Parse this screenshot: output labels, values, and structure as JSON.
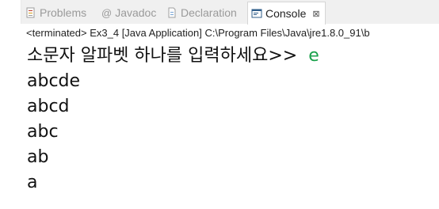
{
  "tabs": [
    {
      "label": "Problems",
      "icon": "problems-icon",
      "active": false
    },
    {
      "label": "Javadoc",
      "icon": "javadoc-icon",
      "active": false
    },
    {
      "label": "Declaration",
      "icon": "declaration-icon",
      "active": false
    },
    {
      "label": "Console",
      "icon": "console-icon",
      "active": true,
      "close_glyph": "⊠"
    }
  ],
  "status": "<terminated> Ex3_4 [Java Application] C:\\Program Files\\Java\\jre1.8.0_91\\b",
  "console": {
    "prompt": "소문자 알파벳 하나를 입력하세요>>",
    "user_input": "e",
    "output_lines": [
      "abcde",
      "abcd",
      "abc",
      "ab",
      "a"
    ]
  },
  "colors": {
    "input_green": "#1aa14b",
    "tabbar_bg": "#f0f0f0",
    "inactive_text": "#9a9a9a"
  }
}
